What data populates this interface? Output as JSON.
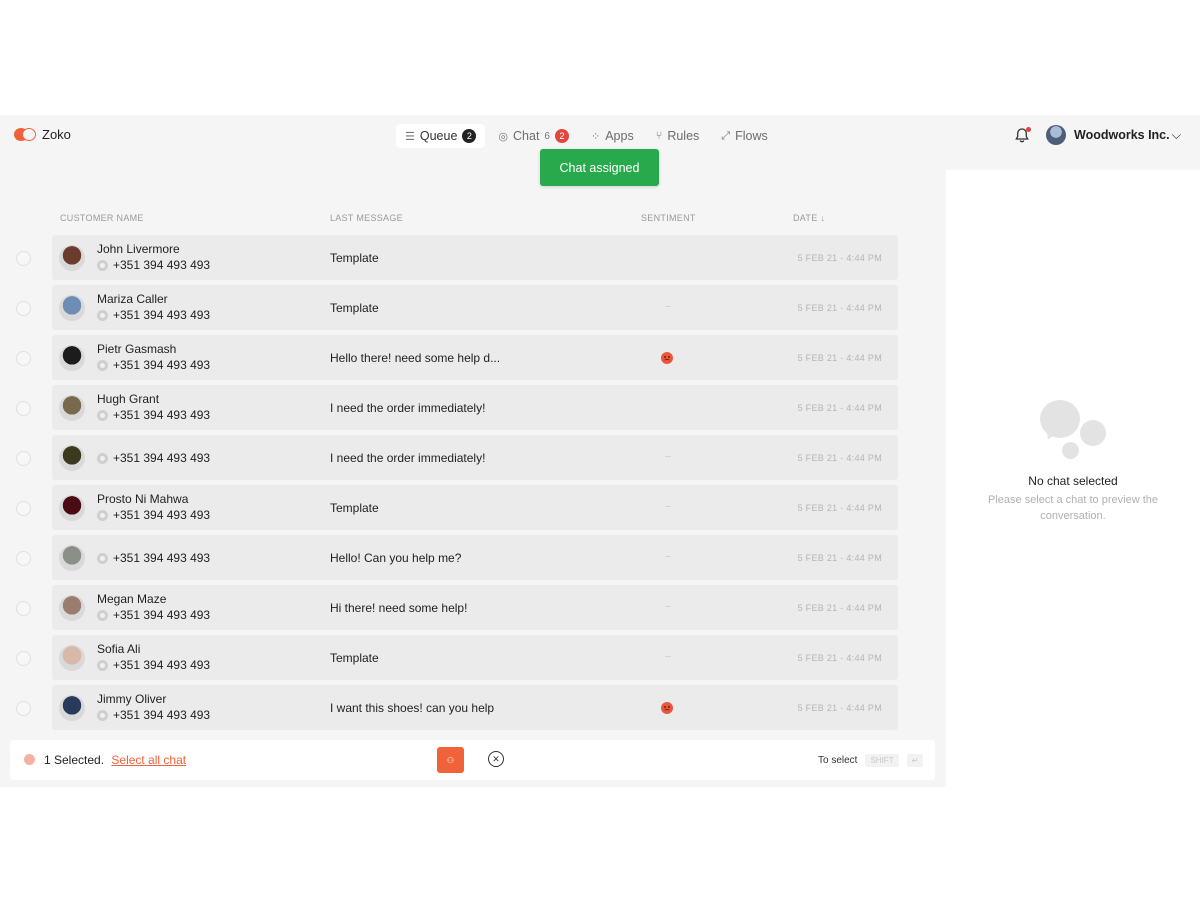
{
  "brand": {
    "name": "Zoko"
  },
  "nav": [
    {
      "label": "Queue",
      "icon": "queue-icon",
      "badge": "2",
      "active": true
    },
    {
      "label": "Chat",
      "icon": "chat-icon",
      "count": "6",
      "badge": "2"
    },
    {
      "label": "Apps",
      "icon": "apps-icon"
    },
    {
      "label": "Rules",
      "icon": "rules-icon"
    },
    {
      "label": "Flows",
      "icon": "flows-icon"
    }
  ],
  "toast": {
    "text": "Chat assigned",
    "color": "#28a94b"
  },
  "org": {
    "name": "Woodworks Inc."
  },
  "table": {
    "headers": {
      "customer": "CUSTOMER NAME",
      "last_message": "LAST MESSAGE",
      "sentiment": "SENTIMENT",
      "date": "DATE ↓"
    },
    "rows": [
      {
        "name": "John Livermore",
        "phone": "+351 394 493 493",
        "message": "Template",
        "sentiment": "",
        "date": "5 FEB 21 - 4:44 PM",
        "avatar_color": "#6b3b2e"
      },
      {
        "name": "Mariza Caller",
        "phone": "+351 394 493 493",
        "message": "Template",
        "sentiment": "–",
        "date": "5 FEB 21 - 4:44 PM",
        "avatar_color": "#6f8cb5"
      },
      {
        "name": "Pietr Gasmash",
        "phone": "+351 394 493 493",
        "message": "Hello there! need some help d...",
        "sentiment": "angry",
        "date": "5 FEB 21 - 4:44 PM",
        "avatar_color": "#1c1c1c"
      },
      {
        "name": "Hugh Grant",
        "phone": "+351 394 493 493",
        "message": "I need the order immediately!",
        "sentiment": "",
        "date": "5 FEB 21 - 4:44 PM",
        "avatar_color": "#7a6a4d"
      },
      {
        "name": "",
        "phone": "+351 394 493 493",
        "message": "I need the order immediately!",
        "sentiment": "–",
        "date": "5 FEB 21 - 4:44 PM",
        "avatar_color": "#3c3a1e"
      },
      {
        "name": "Prosto Ni Mahwa",
        "phone": "+351 394 493 493",
        "message": "Template",
        "sentiment": "–",
        "date": "5 FEB 21 - 4:44 PM",
        "avatar_color": "#4a0b14"
      },
      {
        "name": "",
        "phone": "+351 394 493 493",
        "message": "Hello! Can you help me?",
        "sentiment": "–",
        "date": "5 FEB 21 - 4:44 PM",
        "avatar_color": "#8a8f88"
      },
      {
        "name": "Megan Maze",
        "phone": "+351 394 493 493",
        "message": "Hi there! need some help!",
        "sentiment": "–",
        "date": "5 FEB 21 - 4:44 PM",
        "avatar_color": "#9a7d6e"
      },
      {
        "name": "Sofia Ali",
        "phone": "+351 394 493 493",
        "message": "Template",
        "sentiment": "–",
        "date": "5 FEB 21 - 4:44 PM",
        "avatar_color": "#d8b8a8"
      },
      {
        "name": "Jimmy Oliver",
        "phone": "+351 394 493 493",
        "message": "I want this shoes! can you help",
        "sentiment": "angry",
        "date": "5 FEB 21 - 4:44 PM",
        "avatar_color": "#2a3a5a"
      }
    ]
  },
  "bottom": {
    "selected_text": "1 Selected.",
    "select_all": "Select all chat",
    "to_select": "To select",
    "key_shift": "SHIFT",
    "key_enter": "↵"
  },
  "preview": {
    "title": "No chat selected",
    "subtitle": "Please select a chat to preview the conversation."
  },
  "colors": {
    "accent": "#f0623a",
    "success": "#28a94b",
    "danger": "#e3463d"
  }
}
